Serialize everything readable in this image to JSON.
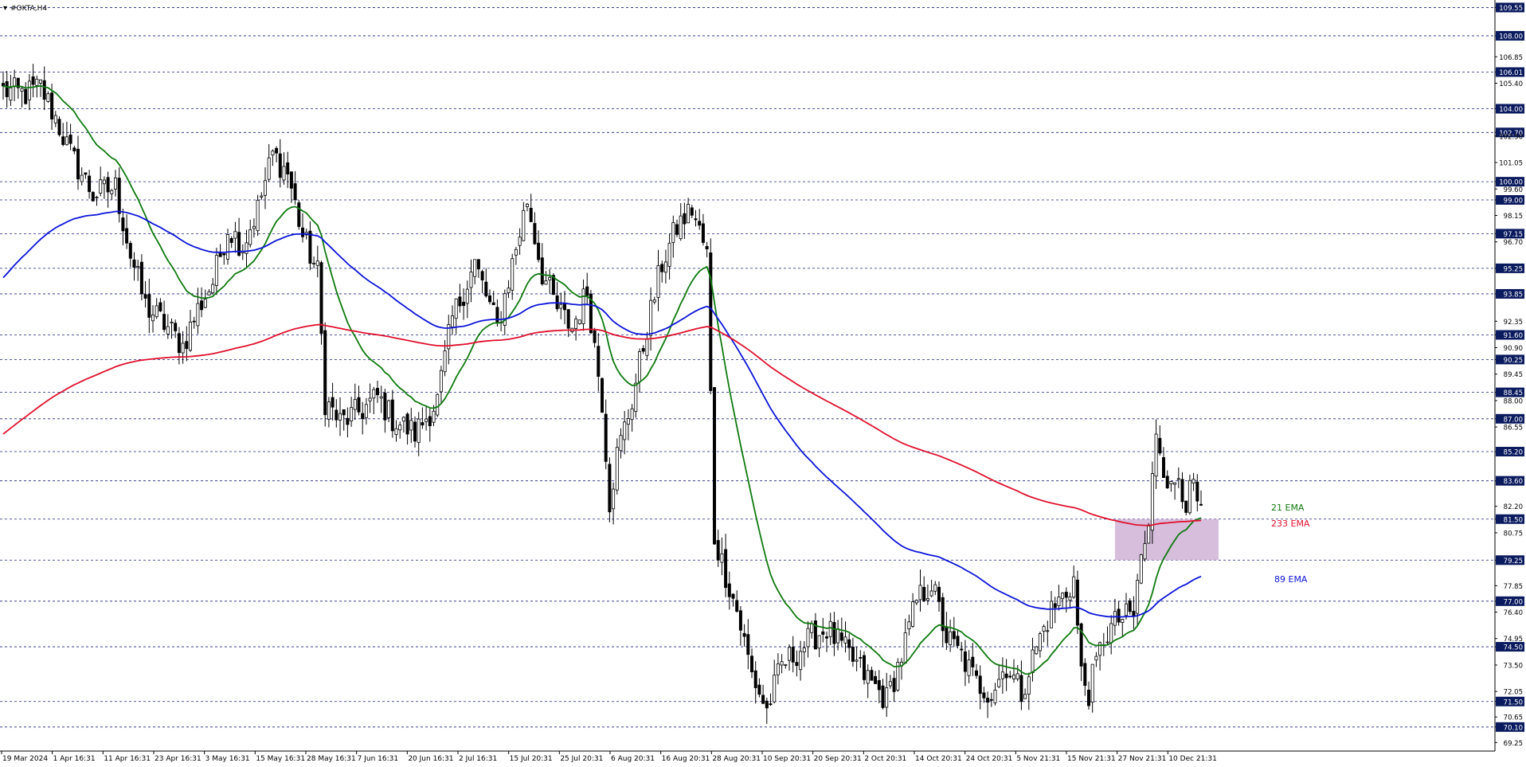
{
  "window": {
    "title": "#OKTA,H4"
  },
  "colors": {
    "background": "#ffffff",
    "candle": "#000000",
    "grid": "#1a237e",
    "axis": "#000000",
    "level_bg": "#0a1a5e",
    "level_text": "#ffffff",
    "zone": "#c9a8d0"
  },
  "chart_data": {
    "type": "candlestick",
    "symbol": "#OKTA",
    "timeframe": "H4",
    "ylim": [
      69.0,
      109.7
    ],
    "y_ticks": [
      "109.55",
      "108.00",
      "106.85",
      "106.01",
      "105.40",
      "104.00",
      "102.70",
      "102.50",
      "101.05",
      "100.00",
      "99.60",
      "99.00",
      "98.15",
      "97.15",
      "96.70",
      "95.25",
      "93.85",
      "92.35",
      "91.60",
      "90.90",
      "90.25",
      "89.45",
      "88.45",
      "88.00",
      "87.00",
      "86.55",
      "85.20",
      "83.60",
      "82.20",
      "81.50",
      "80.75",
      "79.25",
      "77.85",
      "77.00",
      "76.40",
      "74.95",
      "74.50",
      "73.50",
      "72.05",
      "71.50",
      "70.65",
      "70.10",
      "69.25"
    ],
    "level_lines": [
      "109.55",
      "108.00",
      "106.01",
      "104.00",
      "102.70",
      "100.00",
      "99.00",
      "97.15",
      "95.25",
      "93.85",
      "91.60",
      "90.25",
      "88.45",
      "87.00",
      "85.20",
      "83.60",
      "81.50",
      "79.25",
      "77.00",
      "74.50",
      "71.50",
      "70.10"
    ],
    "x_ticks": [
      "19 Mar 2024",
      "1 Apr 16:31",
      "11 Apr 16:31",
      "23 Apr 16:31",
      "3 May 16:31",
      "15 May 16:31",
      "28 May 16:31",
      "7 Jun 16:31",
      "20 Jun 16:31",
      "2 Jul 16:31",
      "15 Jul 20:31",
      "25 Jul 20:31",
      "6 Aug 20:31",
      "16 Aug 20:31",
      "28 Aug 20:31",
      "10 Sep 20:31",
      "20 Sep 20:31",
      "2 Oct 20:31",
      "14 Oct 20:31",
      "24 Oct 20:31",
      "5 Nov 21:31",
      "15 Nov 21:31",
      "27 Nov 21:31",
      "10 Dec 21:31"
    ],
    "price_path": [
      {
        "t": 0,
        "p": 105.0
      },
      {
        "t": 6,
        "p": 104.8
      },
      {
        "t": 10,
        "p": 105.2
      },
      {
        "t": 14,
        "p": 103.5
      },
      {
        "t": 18,
        "p": 101.5
      },
      {
        "t": 24,
        "p": 99.3
      },
      {
        "t": 30,
        "p": 99.7
      },
      {
        "t": 34,
        "p": 96.0
      },
      {
        "t": 38,
        "p": 93.2
      },
      {
        "t": 44,
        "p": 92.0
      },
      {
        "t": 48,
        "p": 91.0
      },
      {
        "t": 52,
        "p": 93.0
      },
      {
        "t": 56,
        "p": 94.5
      },
      {
        "t": 60,
        "p": 97.5
      },
      {
        "t": 64,
        "p": 96.5
      },
      {
        "t": 68,
        "p": 98.5
      },
      {
        "t": 72,
        "p": 101.5
      },
      {
        "t": 76,
        "p": 100.5
      },
      {
        "t": 80,
        "p": 97.0
      },
      {
        "t": 84,
        "p": 95.0
      },
      {
        "t": 86,
        "p": 88.0
      },
      {
        "t": 90,
        "p": 86.8
      },
      {
        "t": 96,
        "p": 87.5
      },
      {
        "t": 100,
        "p": 88.2
      },
      {
        "t": 104,
        "p": 87.0
      },
      {
        "t": 110,
        "p": 86.2
      },
      {
        "t": 116,
        "p": 88.0
      },
      {
        "t": 120,
        "p": 92.5
      },
      {
        "t": 126,
        "p": 95.5
      },
      {
        "t": 132,
        "p": 92.0
      },
      {
        "t": 136,
        "p": 95.5
      },
      {
        "t": 140,
        "p": 99.0
      },
      {
        "t": 144,
        "p": 95.0
      },
      {
        "t": 148,
        "p": 93.0
      },
      {
        "t": 152,
        "p": 92.0
      },
      {
        "t": 156,
        "p": 94.0
      },
      {
        "t": 160,
        "p": 88.0
      },
      {
        "t": 162,
        "p": 82.5
      },
      {
        "t": 164,
        "p": 85.0
      },
      {
        "t": 168,
        "p": 88.0
      },
      {
        "t": 172,
        "p": 92.0
      },
      {
        "t": 176,
        "p": 95.5
      },
      {
        "t": 180,
        "p": 97.5
      },
      {
        "t": 184,
        "p": 98.5
      },
      {
        "t": 188,
        "p": 96.0
      },
      {
        "t": 190,
        "p": 80.5
      },
      {
        "t": 196,
        "p": 76.5
      },
      {
        "t": 200,
        "p": 73.0
      },
      {
        "t": 204,
        "p": 71.0
      },
      {
        "t": 208,
        "p": 73.5
      },
      {
        "t": 212,
        "p": 74.2
      },
      {
        "t": 216,
        "p": 75.0
      },
      {
        "t": 220,
        "p": 75.5
      },
      {
        "t": 224,
        "p": 74.5
      },
      {
        "t": 228,
        "p": 73.5
      },
      {
        "t": 232,
        "p": 72.5
      },
      {
        "t": 236,
        "p": 71.6
      },
      {
        "t": 240,
        "p": 74.0
      },
      {
        "t": 244,
        "p": 77.0
      },
      {
        "t": 248,
        "p": 78.0
      },
      {
        "t": 252,
        "p": 75.0
      },
      {
        "t": 256,
        "p": 74.0
      },
      {
        "t": 260,
        "p": 72.5
      },
      {
        "t": 264,
        "p": 72.0
      },
      {
        "t": 268,
        "p": 73.5
      },
      {
        "t": 272,
        "p": 72.0
      },
      {
        "t": 276,
        "p": 74.5
      },
      {
        "t": 280,
        "p": 76.5
      },
      {
        "t": 284,
        "p": 77.5
      },
      {
        "t": 286,
        "p": 78.2
      },
      {
        "t": 288,
        "p": 73.0
      },
      {
        "t": 290,
        "p": 72.0
      },
      {
        "t": 294,
        "p": 75.0
      },
      {
        "t": 298,
        "p": 76.0
      },
      {
        "t": 302,
        "p": 76.2
      },
      {
        "t": 304,
        "p": 79.5
      },
      {
        "t": 306,
        "p": 80.8
      },
      {
        "t": 308,
        "p": 86.5
      },
      {
        "t": 310,
        "p": 84.5
      },
      {
        "t": 312,
        "p": 83.0
      },
      {
        "t": 314,
        "p": 84.0
      },
      {
        "t": 316,
        "p": 82.5
      },
      {
        "t": 318,
        "p": 83.2
      },
      {
        "t": 320,
        "p": 81.5
      }
    ],
    "last_index": 320,
    "series": [
      {
        "name": "21 EMA",
        "color": "#0e7a0e",
        "period": 21
      },
      {
        "name": "89 EMA",
        "color": "#0a14d8",
        "period": 89
      },
      {
        "name": "233 EMA",
        "color": "#e0102c",
        "period": 233
      }
    ],
    "zone": {
      "x_from": "20 Nov",
      "x_to": "13 Dec",
      "y_from": 79.25,
      "y_to": 81.5
    }
  },
  "labels": {
    "ema21": "21 EMA",
    "ema233": "233 EMA",
    "ema89": "89 EMA"
  }
}
